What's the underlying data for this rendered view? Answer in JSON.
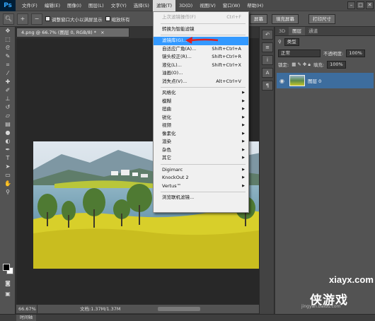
{
  "app": {
    "logo": "Ps"
  },
  "menubar": {
    "items": [
      "文件(F)",
      "编辑(E)",
      "图像(I)",
      "图层(L)",
      "文字(Y)",
      "选择(S)",
      "滤镜(T)",
      "3D(D)",
      "视图(V)",
      "窗口(W)",
      "帮助(H)"
    ],
    "active_index": 6
  },
  "window_controls": {
    "minimize": "–",
    "restore": "□",
    "close": "✕"
  },
  "options_bar": {
    "resize_window_label": "调整窗口大小以满屏显示",
    "zoom_all_label": "缩放所有",
    "fill_screen_label": "填充屏幕",
    "print_size_label": "打印尺寸",
    "screen_label": "屏幕"
  },
  "document": {
    "tab_title": "4.png @ 66.7% (图层 0, RGB/8) *",
    "close_glyph": "×",
    "zoom": "66.67%",
    "doc_size": "文档:1.37M/1.37M"
  },
  "filter_menu": {
    "items": [
      {
        "label": "上次滤镜操作(F)",
        "shortcut": "Ctrl+F",
        "disabled": true
      },
      {
        "sep": true
      },
      {
        "label": "转换为智能滤镜"
      },
      {
        "sep": true
      },
      {
        "label": "滤镜库(G)...",
        "highlighted": true
      },
      {
        "label": "自适应广角(A)...",
        "shortcut": "Shift+Ctrl+A"
      },
      {
        "label": "镜头校正(R)...",
        "shortcut": "Shift+Ctrl+R"
      },
      {
        "label": "液化(L)...",
        "shortcut": "Shift+Ctrl+X"
      },
      {
        "label": "油画(O)..."
      },
      {
        "label": "消失点(V)...",
        "shortcut": "Alt+Ctrl+V"
      },
      {
        "sep": true
      },
      {
        "label": "风格化",
        "submenu": true
      },
      {
        "label": "模糊",
        "submenu": true
      },
      {
        "label": "扭曲",
        "submenu": true
      },
      {
        "label": "锐化",
        "submenu": true
      },
      {
        "label": "视频",
        "submenu": true
      },
      {
        "label": "像素化",
        "submenu": true
      },
      {
        "label": "渲染",
        "submenu": true
      },
      {
        "label": "杂色",
        "submenu": true
      },
      {
        "label": "其它",
        "submenu": true
      },
      {
        "sep": true
      },
      {
        "label": "Digimarc",
        "submenu": true
      },
      {
        "label": "KnockOut 2",
        "submenu": true
      },
      {
        "label": "Vertus™",
        "submenu": true
      },
      {
        "sep": true
      },
      {
        "label": "浏览联机滤镜..."
      }
    ]
  },
  "panels": {
    "tabs": [
      "3D",
      "图层",
      "通道"
    ],
    "active_tab_index": 1,
    "kind_filter": "类型",
    "blend_mode": "正常",
    "opacity_label": "不透明度:",
    "opacity_value": "100%",
    "lock_label": "锁定:",
    "fill_label": "填充:",
    "fill_value": "100%",
    "layer_name": "图层 0"
  },
  "timeline": {
    "label": "时间轴"
  },
  "watermark": {
    "url": "xiayx.com",
    "brand": "侠游戏",
    "sub": "jingyan.baidu.com"
  },
  "colors": {
    "highlight": "#3399ff",
    "arrow": "#e02020",
    "fg_swatch": "#000000",
    "bg_swatch": "#ffffff"
  }
}
